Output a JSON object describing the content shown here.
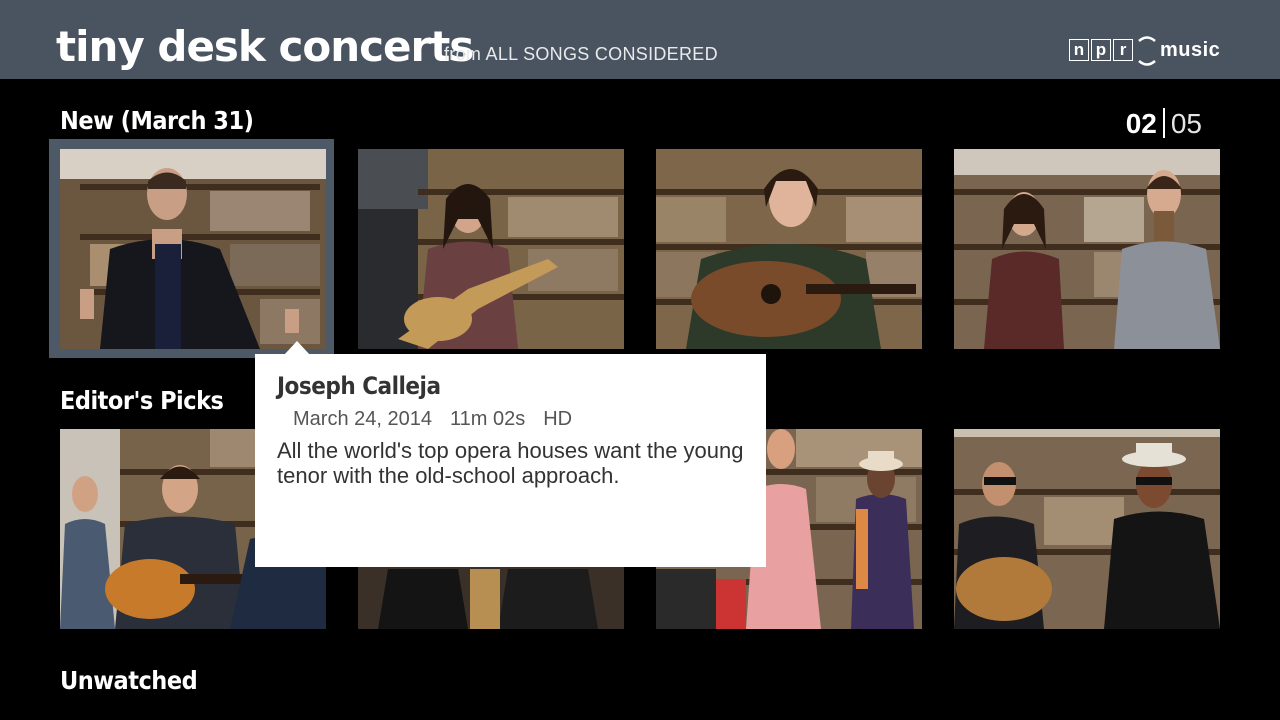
{
  "header": {
    "title": "tiny desk concerts",
    "subtitle": "from ALL SONGS CONSIDERED",
    "logo": {
      "npr_letters": [
        "n",
        "p",
        "r"
      ],
      "music_label": "music"
    }
  },
  "pager": {
    "current": "02",
    "total": "05"
  },
  "sections": [
    {
      "title": "New (March 31)"
    },
    {
      "title": "Editor's Picks"
    },
    {
      "title": "Unwatched"
    }
  ],
  "popup": {
    "name": "Joseph Calleja",
    "date": "March 24, 2014",
    "duration": "11m 02s",
    "quality": "HD",
    "description": "All the world's top opera houses want the young tenor with the old-school approach."
  },
  "colors": {
    "header_bg": "#4a5460",
    "focus_frame": "#4d5966",
    "background": "#000000",
    "popup_bg": "#ffffff"
  }
}
